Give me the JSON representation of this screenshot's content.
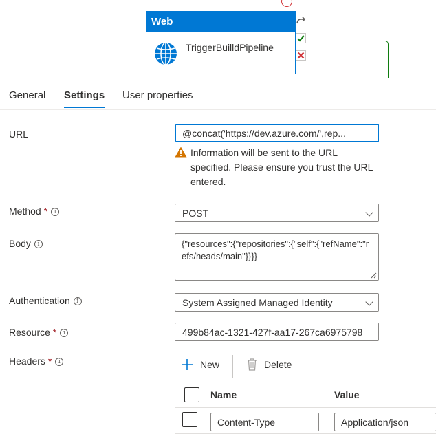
{
  "canvas": {
    "activity_type": "Web",
    "activity_name": "TriggerBuilldPipeline",
    "icon": "globe-icon",
    "side_icons": [
      "redo-icon",
      "success-check-icon",
      "failure-x-icon"
    ],
    "colors": {
      "accent": "#0078d4",
      "success": "#107c10",
      "failure": "#d13438"
    }
  },
  "tabs": [
    {
      "label": "General",
      "active": false
    },
    {
      "label": "Settings",
      "active": true
    },
    {
      "label": "User properties",
      "active": false
    }
  ],
  "form": {
    "url": {
      "label": "URL",
      "value": "@concat('https://dev.azure.com/',rep...",
      "warning": "Information will be sent to the URL specified. Please ensure you trust the URL entered."
    },
    "method": {
      "label": "Method",
      "required_mark": "*",
      "value": "POST"
    },
    "body": {
      "label": "Body",
      "value": "{\"resources\":{\"repositories\":{\"self\":{\"refName\":\"refs/heads/main\"}}}}"
    },
    "authentication": {
      "label": "Authentication",
      "value": "System Assigned Managed Identity"
    },
    "resource": {
      "label": "Resource",
      "required_mark": "*",
      "value": "499b84ac-1321-427f-aa17-267ca6975798"
    },
    "headers": {
      "label": "Headers",
      "required_mark": "*",
      "new_label": "New",
      "delete_label": "Delete",
      "columns": [
        "Name",
        "Value"
      ],
      "rows": [
        {
          "name": "Content-Type",
          "value": "Application/json"
        }
      ]
    }
  }
}
